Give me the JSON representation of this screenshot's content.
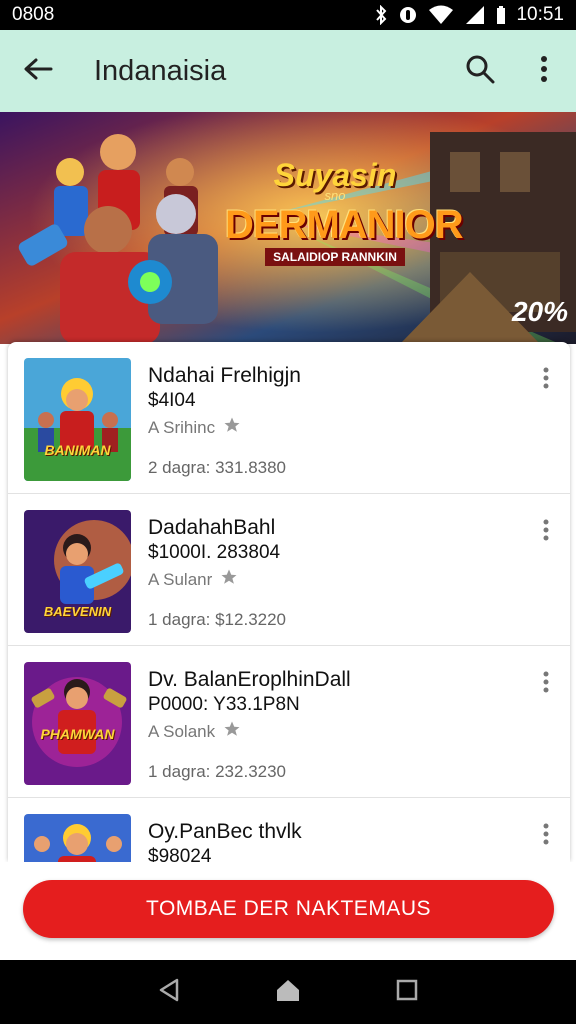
{
  "status_bar": {
    "left_text": "0808",
    "time": "10:51"
  },
  "app_bar": {
    "title": "Indanaisia"
  },
  "banner": {
    "title_top": "Suyasin",
    "title_small": "sno",
    "title_main": "DERMANIOR",
    "subtitle": "SALAIDIOP RANNKIN",
    "badge": "20%"
  },
  "items": [
    {
      "name": "Ndahai Frelhigjn",
      "price": "$4I04",
      "rating": "A Srihinc",
      "meta": "2 dagra: 331.8380",
      "thumb_label": "BANIMAN"
    },
    {
      "name": "DadahahBahl",
      "price": "$1000I. 283804",
      "rating": "A Sulanr",
      "meta": "1 dagra: $12.3220",
      "thumb_label": "BAEVENIN"
    },
    {
      "name": "Dv. BalanEroplhinDall",
      "price": "P0000: Y33.1P8N",
      "rating": "A Solank",
      "meta": "1 dagra: 232.3230",
      "thumb_label": "PHAMWAN"
    },
    {
      "name": "Oy.PanBec thvlk",
      "price": "$98024",
      "rating": "",
      "meta": "",
      "thumb_label": ""
    }
  ],
  "cta": {
    "label": "TOMBAE DER NAKTEMAUS"
  },
  "colors": {
    "app_bar": "#c8efe0",
    "cta": "#e51e1e",
    "status_bar": "#000000"
  },
  "icons": {
    "back": "arrow-left-icon",
    "search": "search-icon",
    "overflow": "more-vert-icon",
    "star": "star-icon",
    "nav_back": "triangle-back-icon",
    "nav_home": "home-icon",
    "nav_recent": "square-recent-icon"
  }
}
